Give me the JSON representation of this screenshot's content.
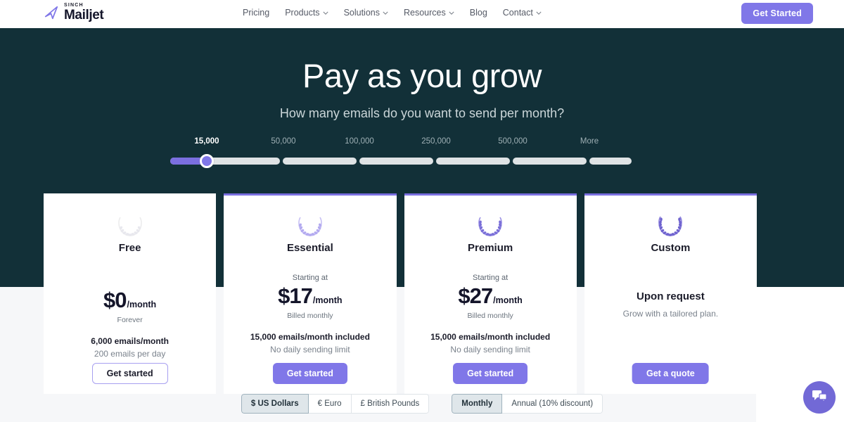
{
  "header": {
    "logo": {
      "top_text": "SINCH",
      "name": "Mailjet",
      "icon": "paper-plane-icon"
    },
    "nav": [
      {
        "label": "Pricing",
        "has_caret": false
      },
      {
        "label": "Products",
        "has_caret": true
      },
      {
        "label": "Solutions",
        "has_caret": true
      },
      {
        "label": "Resources",
        "has_caret": true
      },
      {
        "label": "Blog",
        "has_caret": false
      },
      {
        "label": "Contact",
        "has_caret": true
      }
    ],
    "cta_label": "Get Started",
    "cta_color": "#8077e8"
  },
  "hero": {
    "title": "Pay as you grow",
    "subtitle": "How many emails do you want to send per month?",
    "background_color": "#123038"
  },
  "slider": {
    "name": "email-volume-slider",
    "selected_value": "15,000",
    "ticks": [
      "15,000",
      "50,000",
      "100,000",
      "250,000",
      "500,000",
      "More"
    ],
    "fill_color": "#7b6fe0",
    "track_color": "#dfe3e5"
  },
  "plans": [
    {
      "name": "Free",
      "icon": "laurel-wreath-icon",
      "icon_color": "#e8e8ee",
      "accent": false,
      "starting_at": "",
      "price": "$0",
      "per": "/month",
      "billed": "Forever",
      "included": "6,000 emails/month",
      "limit": "200 emails per day",
      "button_label": "Get started",
      "button_style": "outline"
    },
    {
      "name": "Essential",
      "icon": "laurel-wreath-icon",
      "icon_color": "#b3aaf0",
      "accent": true,
      "starting_at": "Starting at",
      "price": "$17",
      "per": "/month",
      "billed": "Billed monthly",
      "included": "15,000 emails/month included",
      "limit": "No daily sending limit",
      "button_label": "Get started",
      "button_style": "solid"
    },
    {
      "name": "Premium",
      "icon": "laurel-wreath-icon",
      "icon_color": "#7a6fd8",
      "accent": true,
      "starting_at": "Starting at",
      "price": "$27",
      "per": "/month",
      "billed": "Billed monthly",
      "included": "15,000 emails/month included",
      "limit": "No daily sending limit",
      "button_label": "Get started",
      "button_style": "solid"
    },
    {
      "name": "Custom",
      "icon": "laurel-wreath-icon",
      "icon_color": "#6f63cf",
      "accent": true,
      "upon_request": "Upon request",
      "tailored": "Grow with a tailored plan.",
      "button_label": "Get a quote",
      "button_style": "solid"
    }
  ],
  "currency_toggle": {
    "options": [
      "$ US Dollars",
      "€ Euro",
      "£ British Pounds"
    ],
    "selected": "$ US Dollars"
  },
  "billing_toggle": {
    "options": [
      "Monthly",
      "Annual (10% discount)"
    ],
    "selected": "Monthly"
  },
  "chat": {
    "icon": "chat-bubble-icon",
    "color": "#7269d6"
  }
}
